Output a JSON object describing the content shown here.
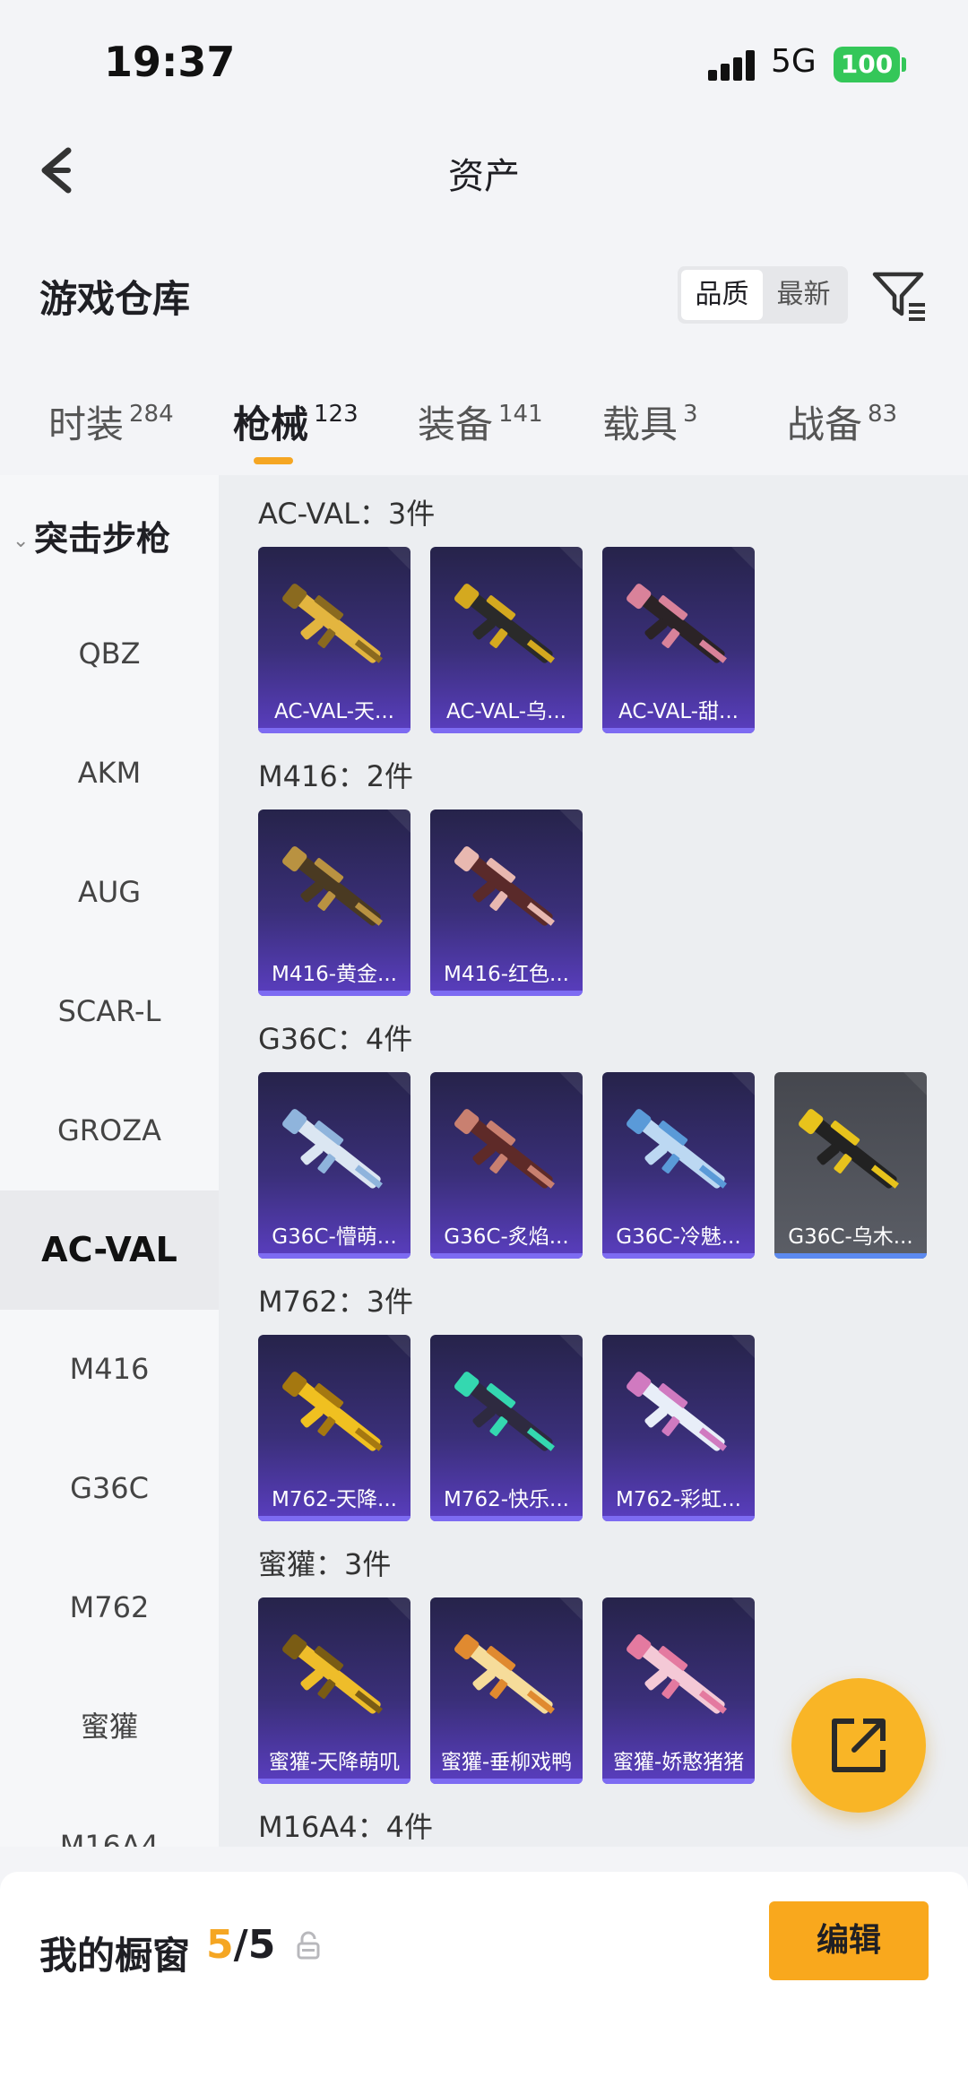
{
  "status_bar": {
    "time": "19:37",
    "network": "5G",
    "battery": "100"
  },
  "nav": {
    "title": "资产"
  },
  "section": {
    "title": "游戏仓库",
    "sort_options": [
      "品质",
      "最新"
    ],
    "sort_selected": "品质"
  },
  "tabs": [
    {
      "label": "时装",
      "count": "284"
    },
    {
      "label": "枪械",
      "count": "123",
      "active": true
    },
    {
      "label": "装备",
      "count": "141"
    },
    {
      "label": "载具",
      "count": "3"
    },
    {
      "label": "战备",
      "count": "83"
    }
  ],
  "sidebar": {
    "category": "突击步枪",
    "items": [
      "QBZ",
      "AKM",
      "AUG",
      "SCAR-L",
      "GROZA",
      "AC-VAL",
      "M416",
      "G36C",
      "M762",
      "蜜獾",
      "M16A4"
    ],
    "active": "AC-VAL"
  },
  "groups": [
    {
      "title": "AC-VAL：3件",
      "items": [
        {
          "label": "AC-VAL-天...",
          "gun_color": "#e3b53f",
          "accent": "#8a6a1f"
        },
        {
          "label": "AC-VAL-乌...",
          "gun_color": "#2a2a2a",
          "accent": "#d4a91f"
        },
        {
          "label": "AC-VAL-甜...",
          "gun_color": "#2b2326",
          "accent": "#d9829a"
        }
      ]
    },
    {
      "title": "M416：2件",
      "items": [
        {
          "label": "M416-黄金...",
          "gun_color": "#4a3a22",
          "accent": "#b99241"
        },
        {
          "label": "M416-红色...",
          "gun_color": "#5a2a2a",
          "accent": "#e8b8b0"
        }
      ]
    },
    {
      "title": "G36C：4件",
      "items": [
        {
          "label": "G36C-懵萌...",
          "gun_color": "#dbe6f2",
          "accent": "#8fb4dc"
        },
        {
          "label": "G36C-炙焰...",
          "gun_color": "#5e2a28",
          "accent": "#c98070"
        },
        {
          "label": "G36C-冷魅...",
          "gun_color": "#bcd8f2",
          "accent": "#5a9ad8"
        },
        {
          "label": "G36C-乌木...",
          "gun_color": "#222222",
          "accent": "#e8c31c",
          "grey": true
        }
      ]
    },
    {
      "title": "M762：3件",
      "items": [
        {
          "label": "M762-天降...",
          "gun_color": "#f0c020",
          "accent": "#a57810"
        },
        {
          "label": "M762-快乐...",
          "gun_color": "#2e2a40",
          "accent": "#34d8b0"
        },
        {
          "label": "M762-彩虹...",
          "gun_color": "#e8eef8",
          "accent": "#d07ac0"
        }
      ]
    },
    {
      "title": "蜜獾：3件",
      "items": [
        {
          "label": "蜜獾-天降萌叽",
          "gun_color": "#eebd2a",
          "accent": "#7a5c14"
        },
        {
          "label": "蜜獾-垂柳戏鸭",
          "gun_color": "#f6dc9a",
          "accent": "#e08a30"
        },
        {
          "label": "蜜獾-娇憨猪猪",
          "gun_color": "#f4c9d6",
          "accent": "#e47aa0"
        }
      ]
    },
    {
      "title": "M16A4：4件",
      "items": []
    }
  ],
  "showcase": {
    "label": "我的橱窗",
    "current": "5",
    "total": "/5",
    "edit_label": "编辑"
  }
}
